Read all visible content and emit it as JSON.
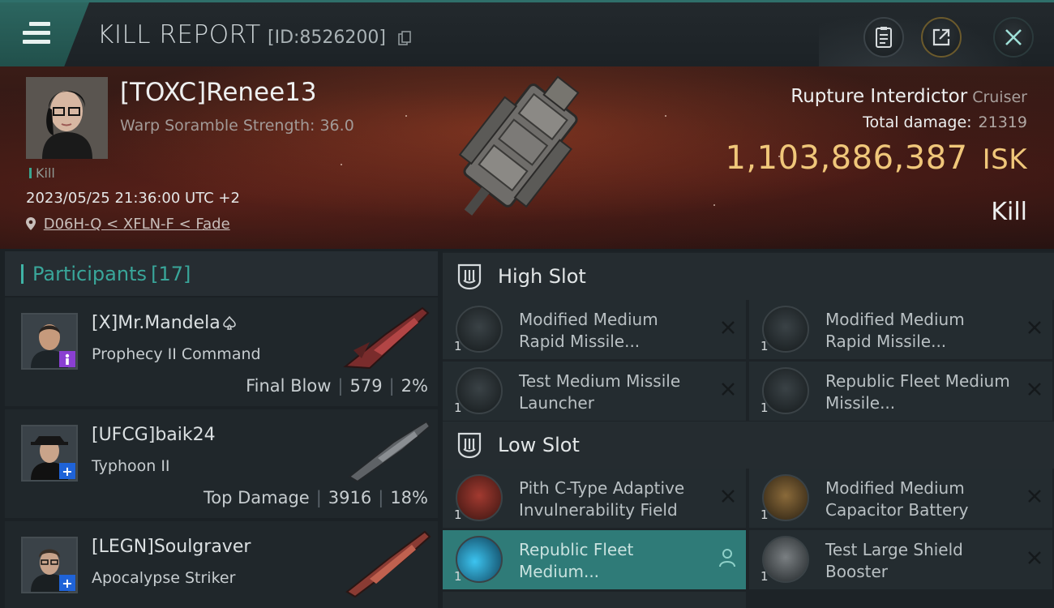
{
  "header": {
    "title": "KILL REPORT",
    "report_id": "[ID:8526200]",
    "icons": [
      "menu-icon",
      "copy-icon",
      "clipboard-icon",
      "share-icon",
      "close-icon"
    ]
  },
  "victim": {
    "name": "[TOXC]Renee13",
    "warp_scramble": "Warp Soramble Strength: 36.0",
    "tag": "Kill",
    "datetime": "2023/05/25 21:36:00 UTC +2",
    "location": "D06H-Q < XFLN-F < Fade",
    "ship": "Rupture Interdictor",
    "ship_class": "Cruiser",
    "damage_label": "Total damage:",
    "damage_value": "21319",
    "isk_value": "1,103,886,387",
    "isk_unit": "ISK",
    "result": "Kill"
  },
  "participants": {
    "label": "Participants",
    "count": "[17]",
    "rows": [
      {
        "name": "[X]Mr.Mandela",
        "name_icon": "spade-icon",
        "ship": "Prophecy II Command",
        "role": "Final Blow",
        "damage": "579",
        "percent": "2%",
        "badge": "purple"
      },
      {
        "name": "[UFCG]baik24",
        "ship": "Typhoon II",
        "role": "Top Damage",
        "damage": "3916",
        "percent": "18%",
        "badge": "blue"
      },
      {
        "name": "[LEGN]Soulgraver",
        "ship": "Apocalypse Striker",
        "role": "",
        "damage": "",
        "percent": "",
        "badge": "blue"
      }
    ]
  },
  "fitting": {
    "high_slot": {
      "title": "High Slot",
      "modules": [
        {
          "name": "Modified Medium Rapid Missile...",
          "qty": "1"
        },
        {
          "name": "Modified Medium Rapid Missile...",
          "qty": "1"
        },
        {
          "name": "Test Medium Missile Launcher",
          "qty": "1"
        },
        {
          "name": "Republic Fleet Medium Missile...",
          "qty": "1"
        }
      ]
    },
    "low_slot": {
      "title": "Low Slot",
      "modules": [
        {
          "name": "Pith C-Type Adaptive Invulnerability Field",
          "qty": "1"
        },
        {
          "name": "Modified Medium Capacitor Battery",
          "qty": "1"
        },
        {
          "name": "Republic Fleet Medium...",
          "qty": "1"
        },
        {
          "name": "Test Large Shield Booster",
          "qty": "1"
        }
      ]
    }
  },
  "colors": {
    "accent": "#3fb4a6",
    "isk": "#f0c77a",
    "highlight": "#2f7b78",
    "badge_purple": "#8a3fd1",
    "badge_blue": "#1f63d8"
  }
}
